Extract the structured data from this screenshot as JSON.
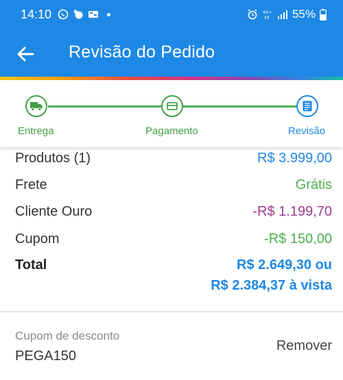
{
  "status_bar": {
    "time": "14:10",
    "battery": "55%",
    "left_icons": [
      "whatsapp-icon",
      "notification-icon",
      "app-icon",
      "dot-icon"
    ],
    "right_icons": [
      "alarm-icon",
      "4g-icon",
      "signal-icon",
      "battery-icon"
    ]
  },
  "app_bar": {
    "title": "Revisão do Pedido",
    "back_icon": "arrow-left-icon",
    "color": "#1e88e5"
  },
  "stepper": {
    "steps": [
      {
        "label": "Entrega",
        "icon": "truck-icon",
        "state": "done",
        "color": "#43a047"
      },
      {
        "label": "Pagamento",
        "icon": "card-icon",
        "state": "done",
        "color": "#43a047"
      },
      {
        "label": "Revisão",
        "icon": "document-icon",
        "state": "active",
        "color": "#1e88e5"
      }
    ]
  },
  "summary": {
    "products": {
      "label": "Produtos (1)",
      "value": "R$ 3.999,00"
    },
    "shipping": {
      "label": "Frete",
      "value": "Grátis"
    },
    "gold_client": {
      "label": "Cliente Ouro",
      "value": "-R$ 1.199,70"
    },
    "coupon": {
      "label": "Cupom",
      "value": "-R$ 150,00"
    },
    "total": {
      "label": "Total",
      "value_line1": "R$ 2.649,30 ou",
      "value_line2": "R$ 2.384,37 à vista"
    }
  },
  "coupon_section": {
    "caption": "Cupom de desconto",
    "code": "PEGA150",
    "remove_label": "Remover"
  },
  "colors": {
    "primary": "#1e88e5",
    "success": "#4caf50",
    "discount_purple": "#9c3d8e"
  }
}
